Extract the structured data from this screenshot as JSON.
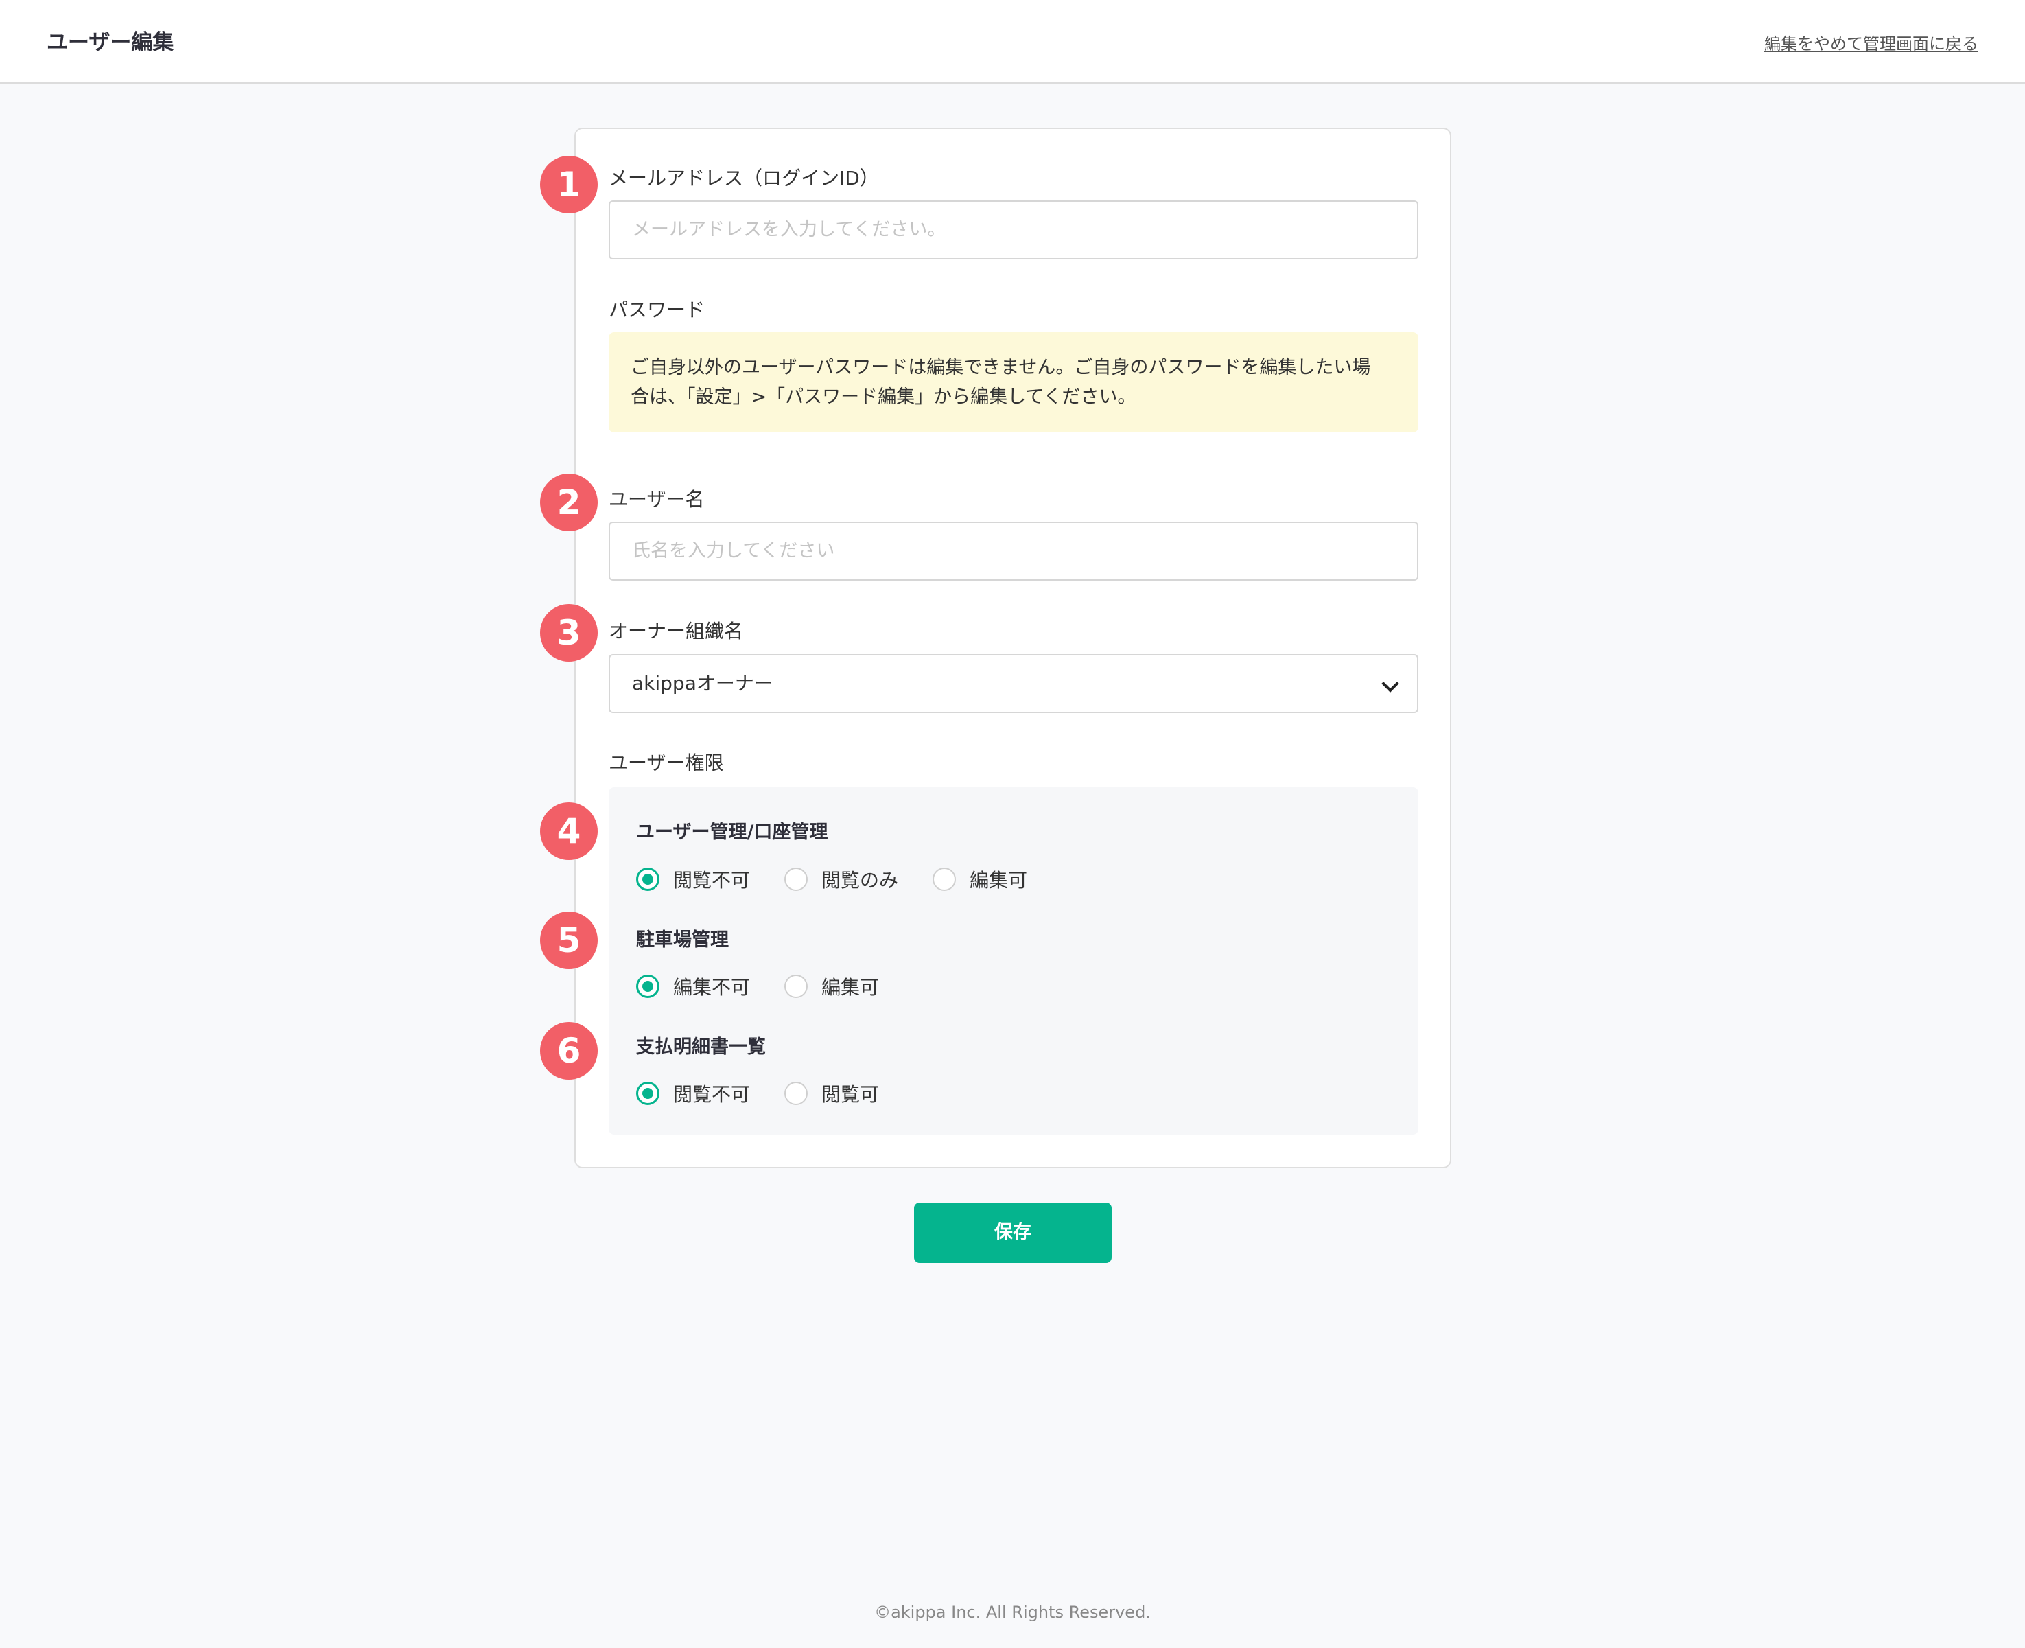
{
  "header": {
    "title": "ユーザー編集",
    "back_link": "編集をやめて管理画面に戻る"
  },
  "form": {
    "email": {
      "label": "メールアドレス（ログインID）",
      "placeholder": "メールアドレスを入力してください。",
      "value": ""
    },
    "password": {
      "label": "パスワード",
      "notice_line1": "ご自身以外のユーザーパスワードは編集できません。ご自身のパスワードを編集したい場",
      "notice_line2": "合は、「設定」>「パスワード編集」から編集してください。"
    },
    "username": {
      "label": "ユーザー名",
      "placeholder": "氏名を入力してください",
      "value": ""
    },
    "owner_org": {
      "label": "オーナー組織名",
      "selected": "akippaオーナー"
    },
    "permissions": {
      "label": "ユーザー権限",
      "groups": [
        {
          "title": "ユーザー管理/口座管理",
          "options": [
            "閲覧不可",
            "閲覧のみ",
            "編集可"
          ],
          "selected": "閲覧不可"
        },
        {
          "title": "駐車場管理",
          "options": [
            "編集不可",
            "編集可"
          ],
          "selected": "編集不可"
        },
        {
          "title": "支払明細書一覧",
          "options": [
            "閲覧不可",
            "閲覧可"
          ],
          "selected": "閲覧不可"
        }
      ]
    },
    "save_label": "保存"
  },
  "annotations": [
    "1",
    "2",
    "3",
    "4",
    "5",
    "6"
  ],
  "footer": "©akippa Inc. All Rights Reserved.",
  "colors": {
    "accent": "#05b48e",
    "badge": "#f25f67",
    "notice_bg": "#fdf9d9"
  }
}
